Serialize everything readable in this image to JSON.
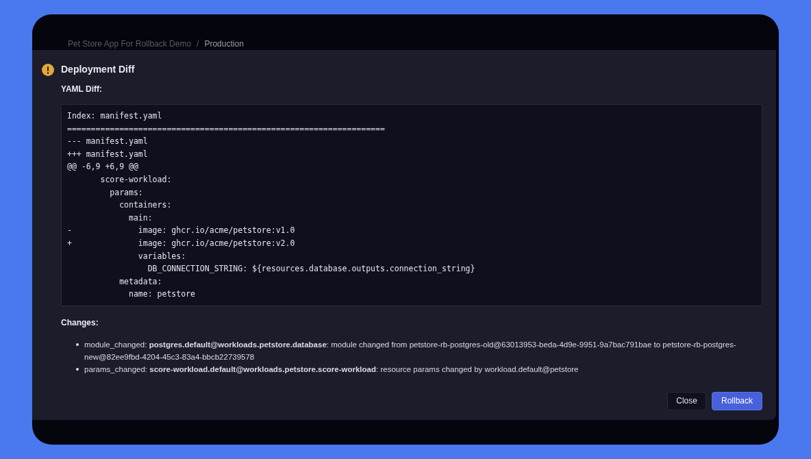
{
  "breadcrumb": [
    "Pet Store App For Rollback Demo",
    "/",
    "Production"
  ],
  "dialog": {
    "title": "Deployment Diff",
    "diff_label": "YAML Diff:",
    "diff_lines": [
      "Index: manifest.yaml",
      "===================================================================",
      "--- manifest.yaml",
      "+++ manifest.yaml",
      "@@ -6,9 +6,9 @@",
      "       score-workload:",
      "         params:",
      "           containers:",
      "             main:",
      "-              image: ghcr.io/acme/petstore:v1.0",
      "+              image: ghcr.io/acme/petstore:v2.0",
      "               variables:",
      "                 DB_CONNECTION_STRING: ${resources.database.outputs.connection_string}",
      "           metadata:",
      "             name: petstore"
    ],
    "changes_label": "Changes:",
    "changes": [
      "module_changed: **postgres.default@workloads.petstore.database**: module changed from petstore-rb-postgres-old@63013953-beda-4d9e-9951-9a7bac791bae to petstore-rb-postgres-new@82ee9fbd-4204-45c3-83a4-bbcb22739578",
      "params_changed: **score-workload.default@workloads.petstore.score-workload**: resource params changed by workload.default@petstore"
    ],
    "buttons": [
      {
        "label": "Close",
        "kind": "secondary"
      },
      {
        "label": "Rollback",
        "kind": "primary"
      }
    ]
  }
}
